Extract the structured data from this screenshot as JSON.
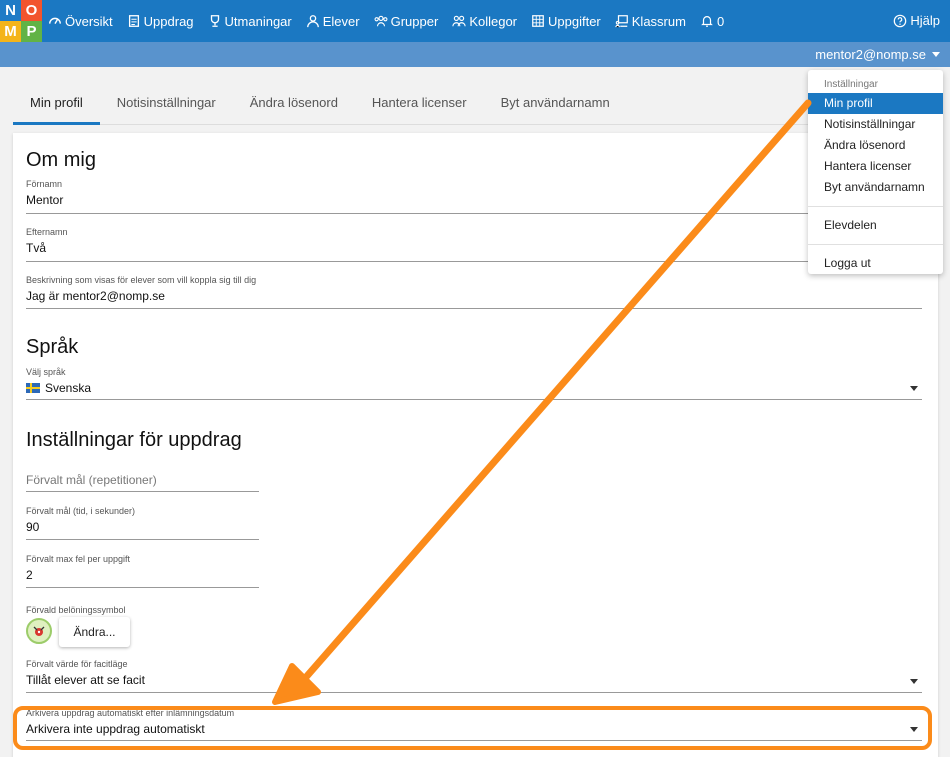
{
  "logo": {
    "letters": [
      "N",
      "O",
      "M",
      "P"
    ],
    "colors": [
      "#1f7bc6",
      "#f2542d",
      "#f4b41a",
      "#62b346"
    ]
  },
  "nav": {
    "items": [
      {
        "label": "Översikt",
        "icon": "dashboard-icon"
      },
      {
        "label": "Uppdrag",
        "icon": "document-icon"
      },
      {
        "label": "Utmaningar",
        "icon": "trophy-icon"
      },
      {
        "label": "Elever",
        "icon": "user-icon"
      },
      {
        "label": "Grupper",
        "icon": "users-icon"
      },
      {
        "label": "Kollegor",
        "icon": "colleagues-icon"
      },
      {
        "label": "Uppgifter",
        "icon": "grid-icon"
      },
      {
        "label": "Klassrum",
        "icon": "classroom-icon"
      },
      {
        "label": "0",
        "icon": "bell-icon"
      }
    ],
    "help_label": "Hjälp"
  },
  "user_menu": {
    "email": "mentor2@nomp.se"
  },
  "tabs": [
    "Min profil",
    "Notisinställningar",
    "Ändra lösenord",
    "Hantera licenser",
    "Byt användarnamn"
  ],
  "about": {
    "title": "Om mig",
    "first_name": {
      "label": "Förnamn",
      "value": "Mentor"
    },
    "last_name": {
      "label": "Efternamn",
      "value": "Två"
    },
    "description": {
      "label": "Beskrivning som visas för elever som vill koppla sig till dig",
      "value": "Jag är mentor2@nomp.se"
    }
  },
  "language": {
    "title": "Språk",
    "label": "Välj språk",
    "value": "Svenska"
  },
  "assignments": {
    "title": "Inställningar för uppdrag",
    "goal_reps_placeholder": "Förvalt mål (repetitioner)",
    "goal_time": {
      "label": "Förvalt mål (tid, i sekunder)",
      "value": "90"
    },
    "max_errors": {
      "label": "Förvalt max fel per uppgift",
      "value": "2"
    },
    "reward_label": "Förvald belöningssymbol",
    "change_button": "Ändra...",
    "answer_mode": {
      "label": "Förvalt värde för facitläge",
      "value": "Tillåt elever att se facit"
    },
    "archive": {
      "label": "Arkivera uppdrag automatiskt efter inlämningsdatum",
      "value": "Arkivera inte uppdrag automatiskt"
    }
  },
  "dropdown": {
    "header": "Inställningar",
    "items": [
      "Min profil",
      "Notisinställningar",
      "Ändra lösenord",
      "Hantera licenser",
      "Byt användarnamn"
    ],
    "elevdelen": "Elevdelen",
    "logout": "Logga ut"
  },
  "colors": {
    "nav": "#1b78c2",
    "subbar": "#5993cd",
    "annotation": "#fb8b1a"
  }
}
